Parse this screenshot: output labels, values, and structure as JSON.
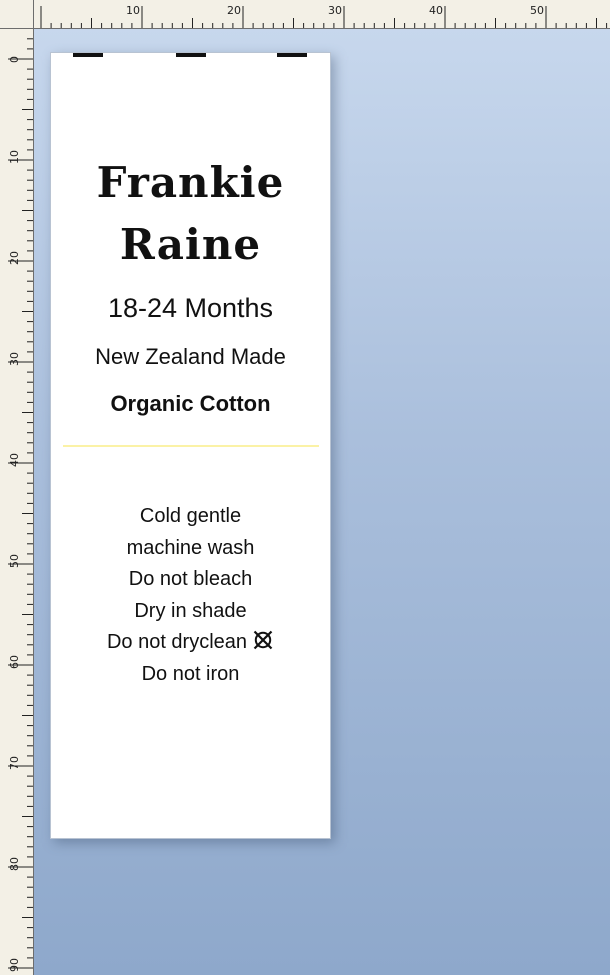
{
  "rulers": {
    "top_labels": [
      "10",
      "20",
      "30",
      "40",
      "50"
    ],
    "left_labels": [
      "0",
      "10",
      "20",
      "30",
      "40",
      "50",
      "60",
      "70",
      "80",
      "90"
    ]
  },
  "label": {
    "brand_line_1": "Frankie",
    "brand_line_2": "Raine",
    "size": "18-24 Months",
    "origin": "New Zealand Made",
    "material": "Organic Cotton",
    "divider_color": "#fbf2a6",
    "care_instructions": [
      "Cold gentle",
      "machine wash",
      "Do not bleach",
      "Dry in shade",
      "Do not dryclean",
      "Do not iron"
    ],
    "care_icon": "do-not-dryclean-icon"
  }
}
